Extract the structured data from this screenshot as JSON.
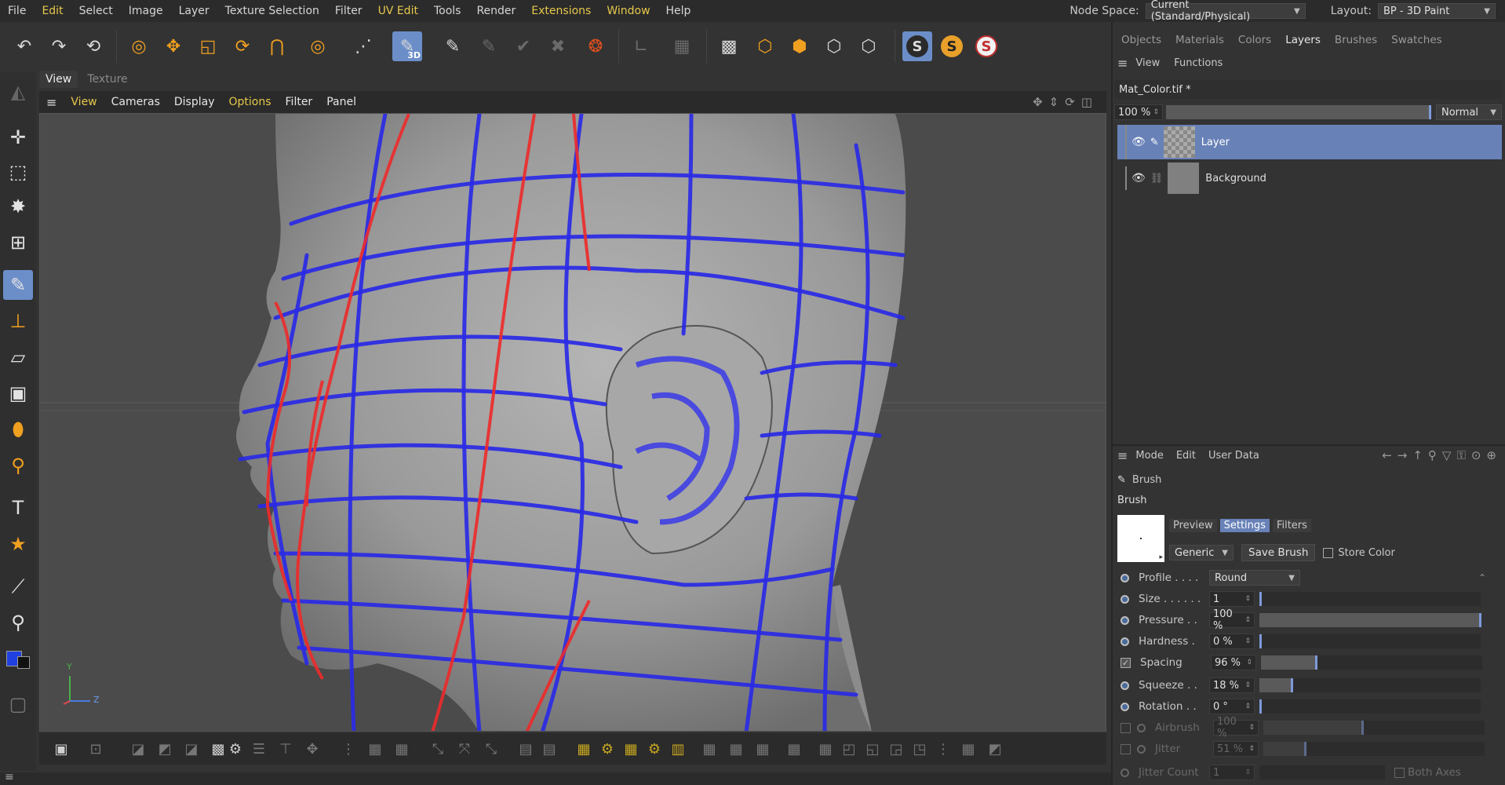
{
  "menubar": {
    "items": [
      "File",
      "Edit",
      "Select",
      "Image",
      "Layer",
      "Texture Selection",
      "Filter",
      "UV Edit",
      "Tools",
      "Render",
      "Extensions",
      "Window",
      "Help"
    ],
    "node_space_label": "Node Space:",
    "node_space_value": "Current (Standard/Physical)",
    "layout_label": "Layout:",
    "layout_value": "BP - 3D Paint"
  },
  "toolbar": {
    "badge_3d": "3D",
    "s_buttons": [
      "S",
      "S",
      "S"
    ]
  },
  "viewport": {
    "tabs": [
      "View",
      "Texture"
    ],
    "menu": [
      "View",
      "Cameras",
      "Display",
      "Options",
      "Filter",
      "Panel"
    ],
    "axis_y": "Y",
    "axis_z": "Z"
  },
  "right": {
    "tabs": [
      "Objects",
      "Materials",
      "Colors",
      "Layers",
      "Brushes",
      "Swatches"
    ],
    "layer_menu": [
      "View",
      "Functions"
    ],
    "texture_name": "Mat_Color.tif *",
    "opacity": "100 %",
    "blend_mode": "Normal",
    "layers": [
      {
        "name": "Layer",
        "selected": true
      },
      {
        "name": "Background",
        "selected": false
      }
    ],
    "attr_menu": [
      "Mode",
      "Edit",
      "User Data"
    ],
    "object_label": "Brush",
    "section_label": "Brush",
    "brush_tabs": [
      "Preview",
      "Settings",
      "Filters"
    ],
    "preset_value": "Generic",
    "save_brush": "Save Brush",
    "store_color": "Store Color",
    "profile_label": "Profile . . . .",
    "profile_value": "Round",
    "params": [
      {
        "label": "Size . . . . . .",
        "value": "1",
        "fraction": 0.0,
        "toggle": "radio",
        "enabled": true
      },
      {
        "label": "Pressure . .",
        "value": "100 %",
        "fraction": 1.0,
        "toggle": "radio",
        "enabled": true
      },
      {
        "label": "Hardness .",
        "value": "0 %",
        "fraction": 0.0,
        "toggle": "radio",
        "enabled": true
      },
      {
        "label": "Spacing",
        "value": "96 %",
        "fraction": 0.25,
        "toggle": "checked",
        "enabled": true
      },
      {
        "label": "Squeeze . .",
        "value": "18 %",
        "fraction": 0.15,
        "toggle": "radio",
        "enabled": true
      },
      {
        "label": "Rotation . .",
        "value": "0 °",
        "fraction": 0.0,
        "toggle": "radio",
        "enabled": true
      },
      {
        "label": "Airbrush",
        "value": "100 %",
        "fraction": 0.45,
        "toggle": "unchecked",
        "enabled": false
      },
      {
        "label": "Jitter",
        "value": "51 %",
        "fraction": 0.19,
        "toggle": "unchecked",
        "enabled": false
      }
    ],
    "jitter_count_label": "Jitter Count",
    "jitter_count_value": "1",
    "both_axes": "Both Axes"
  }
}
